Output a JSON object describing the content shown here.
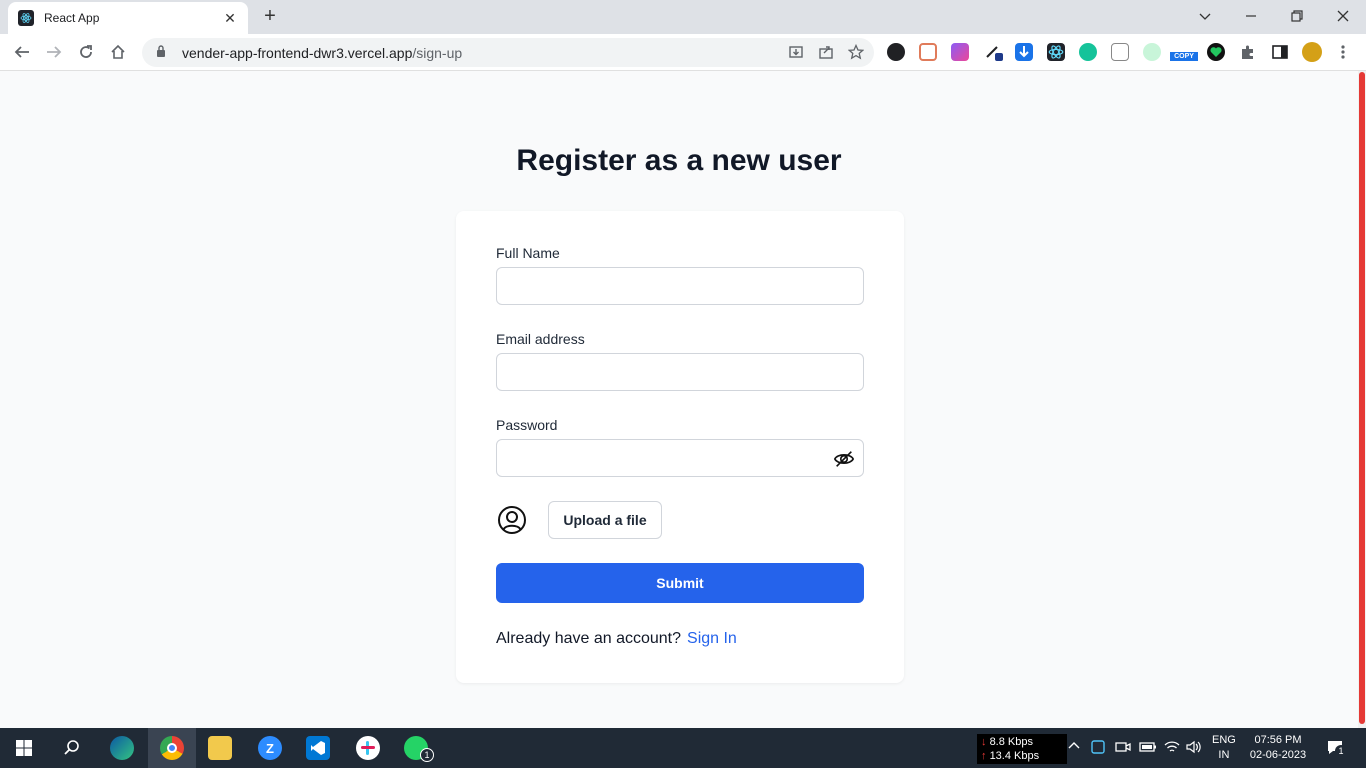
{
  "browser": {
    "tab_title": "React App",
    "tab_close": "✕",
    "new_tab": "+",
    "url_domain": "vender-app-frontend-dwr3.vercel.app",
    "url_path": "/sign-up",
    "extension_copy_badge": "COPY"
  },
  "page": {
    "heading": "Register as a new user",
    "form": {
      "full_name_label": "Full Name",
      "full_name_value": "",
      "email_label": "Email address",
      "email_value": "",
      "password_label": "Password",
      "password_value": "",
      "upload_label": "Upload a file",
      "submit_label": "Submit",
      "signin_prompt": "Already have an account?",
      "signin_link": "Sign In"
    },
    "colors": {
      "primary": "#2563eb",
      "heading": "#111827",
      "background": "#f9fafb"
    }
  },
  "taskbar": {
    "net_down": "8.8 Kbps",
    "net_up": "13.4 Kbps",
    "lang_line1": "ENG",
    "lang_line2": "IN",
    "time": "07:56 PM",
    "date": "02-06-2023",
    "whatsapp_badge": "1",
    "notification_badge": "1"
  }
}
